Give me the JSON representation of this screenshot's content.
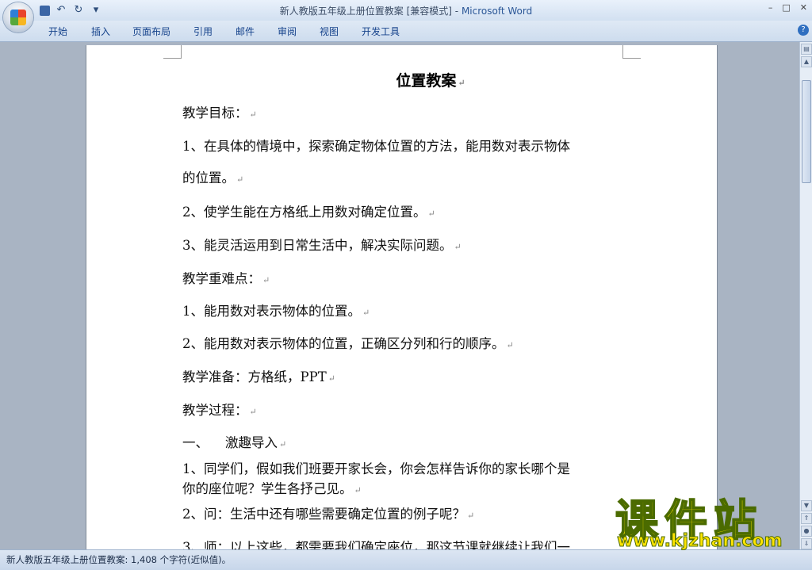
{
  "window": {
    "title_doc": "新人教版五年级上册位置教案 [兼容模式]",
    "title_sep": " - ",
    "title_app": "Microsoft Word"
  },
  "ribbon": {
    "tabs": [
      "开始",
      "插入",
      "页面布局",
      "引用",
      "邮件",
      "审阅",
      "视图",
      "开发工具"
    ]
  },
  "document": {
    "title": "位置教案",
    "paragraphs": [
      "教学目标：",
      "1、在具体的情境中，探索确定物体位置的方法，能用数对表示物体",
      "的位置。",
      "2、使学生能在方格纸上用数对确定位置。",
      "3、能灵活运用到日常生活中，解决实际问题。",
      "教学重难点：",
      "1、能用数对表示物体的位置。",
      "2、能用数对表示物体的位置，正确区分列和行的顺序。",
      "教学准备：方格纸，PPT",
      "教学过程：",
      "一、    激趣导入",
      "1、同学们，假如我们班要开家长会，你会怎样告诉你的家长哪个是",
      "你的座位呢？学生各抒己见。",
      "2、问：生活中还有哪些需要确定位置的例子呢？",
      "3、师：以上这些，都需要我们确定座位，那这节课就继续让我们一"
    ]
  },
  "status": {
    "text": "新人教版五年级上册位置教案: 1,408 个字符(近似值)。"
  },
  "watermark": {
    "big": "课件站",
    "url": "www.kjzhan.com"
  }
}
